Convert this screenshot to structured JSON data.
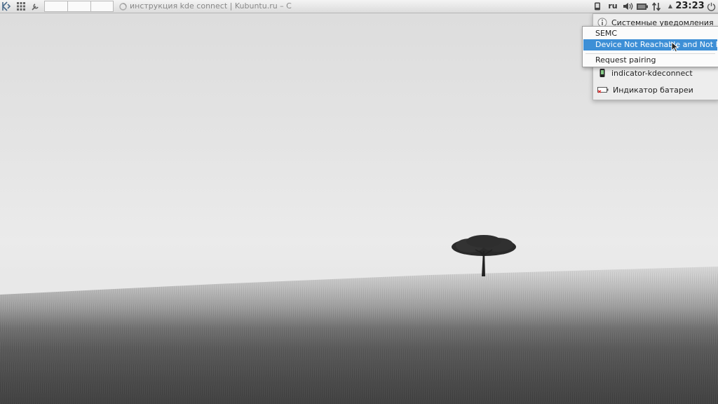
{
  "panel": {
    "task_title": "инструкция kde connect | Kubuntu.ru – C",
    "keyboard_layout": "ru",
    "clock": "23:23"
  },
  "tray_popup": {
    "items": [
      {
        "label": "Системные уведомления",
        "icon": "info-icon"
      },
      {
        "label": "indicator-kdeconnect",
        "icon": "phone-icon"
      },
      {
        "label": "Индикатор батареи",
        "icon": "battery-icon"
      }
    ]
  },
  "context_menu": {
    "title": "SEMC",
    "status": "Device Not Reachable and Not Paired",
    "action": "Request pairing"
  },
  "colors": {
    "menu_highlight": "#3d8fd6",
    "panel": "#e8e8e8"
  }
}
